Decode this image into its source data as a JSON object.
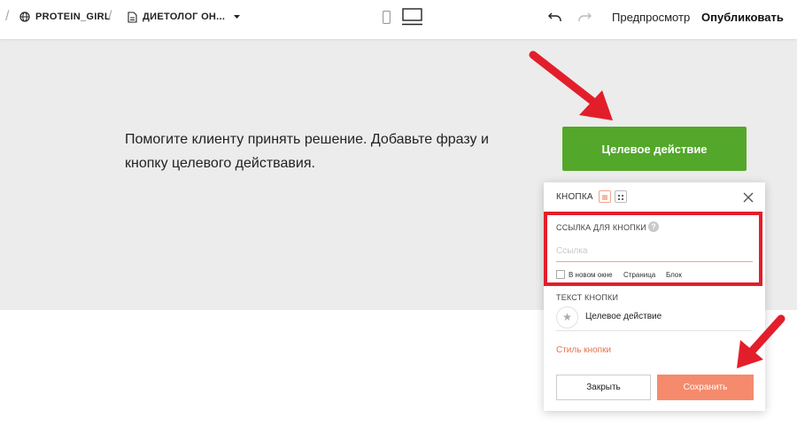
{
  "toolbar": {
    "site_name": "PROTEIN_GIRL",
    "page_name": "ДИЕТОЛОГ ОН...",
    "preview_label": "Предпросмотр",
    "publish_label": "Опубликовать"
  },
  "block": {
    "text_line1": "Помогите клиенту принять решение. Добавьте фразу и",
    "text_line2": "кнопку целевого действавия.",
    "cta_label": "Целевое действие",
    "cta_color": "#53a72a"
  },
  "popup": {
    "title": "КНОПКА",
    "link_section_label": "ССЫЛКА ДЛЯ КНОПКИ",
    "help_icon": "?",
    "link_placeholder": "Ссылка",
    "link_value": "",
    "new_window_label": "В новом окне",
    "page_option": "Страница",
    "block_option": "Блок",
    "button_text_label": "ТЕКСТ КНОПКИ",
    "button_text_value": "Целевое действие",
    "button_style_link": "Стиль кнопки",
    "close_label": "Закрыть",
    "save_label": "Сохранить"
  },
  "colors": {
    "highlight": "#e31e2b",
    "save_button": "#f58b6c",
    "accent_link": "#e8704a",
    "cta": "#53a72a"
  },
  "icons": [
    "globe-icon",
    "page-doc-icon",
    "dropdown-caret-icon",
    "mobile-view-icon",
    "desktop-view-icon",
    "undo-icon",
    "redo-icon",
    "list-view-icon",
    "grid-view-icon",
    "close-icon",
    "help-icon",
    "star-icon",
    "arrow-annotation"
  ]
}
